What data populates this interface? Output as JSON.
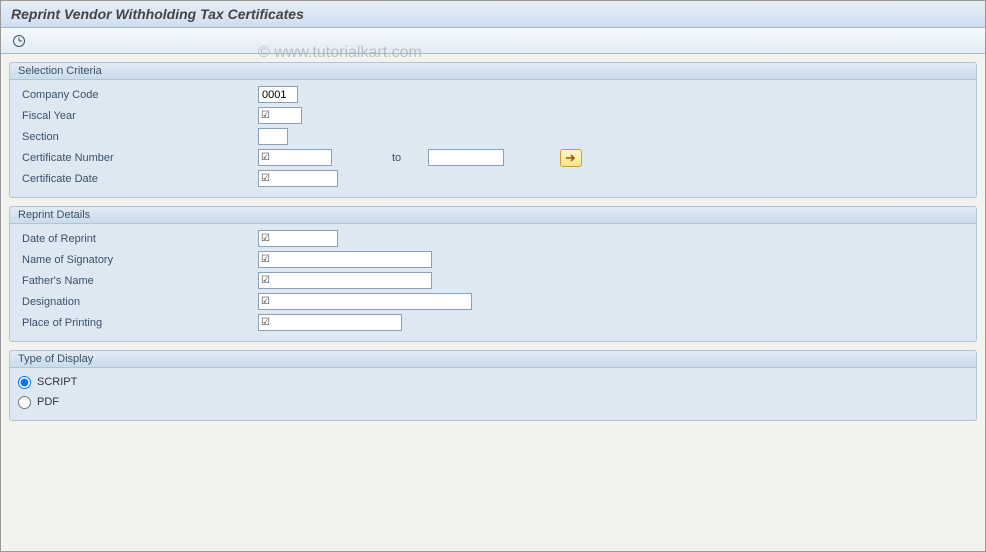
{
  "title": "Reprint Vendor Withholding Tax Certificates",
  "watermark": "© www.tutorialkart.com",
  "groups": {
    "selection": {
      "header": "Selection Criteria",
      "company_code_label": "Company Code",
      "company_code_value": "0001",
      "fiscal_year_label": "Fiscal Year",
      "section_label": "Section",
      "cert_number_label": "Certificate Number",
      "to_label": "to",
      "cert_date_label": "Certificate Date"
    },
    "reprint": {
      "header": "Reprint Details",
      "date_reprint_label": "Date of Reprint",
      "signatory_label": "Name of Signatory",
      "father_label": "Father's Name",
      "designation_label": "Designation",
      "place_label": "Place of Printing"
    },
    "display": {
      "header": "Type of Display",
      "script_label": "SCRIPT",
      "pdf_label": "PDF"
    }
  }
}
